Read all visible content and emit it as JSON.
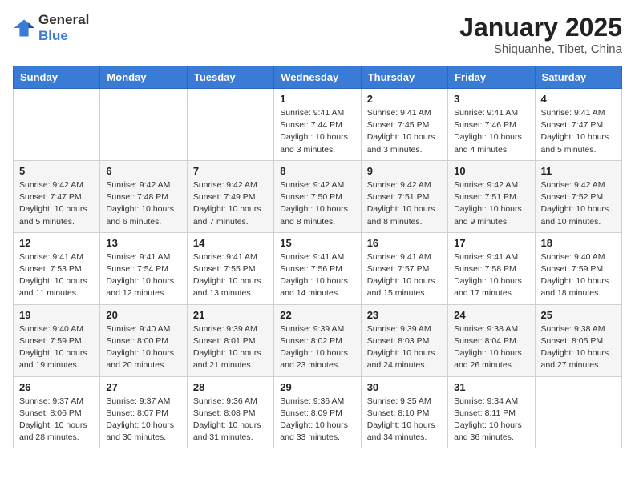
{
  "logo": {
    "general": "General",
    "blue": "Blue"
  },
  "title": "January 2025",
  "subtitle": "Shiquanhe, Tibet, China",
  "days_of_week": [
    "Sunday",
    "Monday",
    "Tuesday",
    "Wednesday",
    "Thursday",
    "Friday",
    "Saturday"
  ],
  "weeks": [
    [
      {
        "day": "",
        "info": ""
      },
      {
        "day": "",
        "info": ""
      },
      {
        "day": "",
        "info": ""
      },
      {
        "day": "1",
        "info": "Sunrise: 9:41 AM\nSunset: 7:44 PM\nDaylight: 10 hours\nand 3 minutes."
      },
      {
        "day": "2",
        "info": "Sunrise: 9:41 AM\nSunset: 7:45 PM\nDaylight: 10 hours\nand 3 minutes."
      },
      {
        "day": "3",
        "info": "Sunrise: 9:41 AM\nSunset: 7:46 PM\nDaylight: 10 hours\nand 4 minutes."
      },
      {
        "day": "4",
        "info": "Sunrise: 9:41 AM\nSunset: 7:47 PM\nDaylight: 10 hours\nand 5 minutes."
      }
    ],
    [
      {
        "day": "5",
        "info": "Sunrise: 9:42 AM\nSunset: 7:47 PM\nDaylight: 10 hours\nand 5 minutes."
      },
      {
        "day": "6",
        "info": "Sunrise: 9:42 AM\nSunset: 7:48 PM\nDaylight: 10 hours\nand 6 minutes."
      },
      {
        "day": "7",
        "info": "Sunrise: 9:42 AM\nSunset: 7:49 PM\nDaylight: 10 hours\nand 7 minutes."
      },
      {
        "day": "8",
        "info": "Sunrise: 9:42 AM\nSunset: 7:50 PM\nDaylight: 10 hours\nand 8 minutes."
      },
      {
        "day": "9",
        "info": "Sunrise: 9:42 AM\nSunset: 7:51 PM\nDaylight: 10 hours\nand 8 minutes."
      },
      {
        "day": "10",
        "info": "Sunrise: 9:42 AM\nSunset: 7:51 PM\nDaylight: 10 hours\nand 9 minutes."
      },
      {
        "day": "11",
        "info": "Sunrise: 9:42 AM\nSunset: 7:52 PM\nDaylight: 10 hours\nand 10 minutes."
      }
    ],
    [
      {
        "day": "12",
        "info": "Sunrise: 9:41 AM\nSunset: 7:53 PM\nDaylight: 10 hours\nand 11 minutes."
      },
      {
        "day": "13",
        "info": "Sunrise: 9:41 AM\nSunset: 7:54 PM\nDaylight: 10 hours\nand 12 minutes."
      },
      {
        "day": "14",
        "info": "Sunrise: 9:41 AM\nSunset: 7:55 PM\nDaylight: 10 hours\nand 13 minutes."
      },
      {
        "day": "15",
        "info": "Sunrise: 9:41 AM\nSunset: 7:56 PM\nDaylight: 10 hours\nand 14 minutes."
      },
      {
        "day": "16",
        "info": "Sunrise: 9:41 AM\nSunset: 7:57 PM\nDaylight: 10 hours\nand 15 minutes."
      },
      {
        "day": "17",
        "info": "Sunrise: 9:41 AM\nSunset: 7:58 PM\nDaylight: 10 hours\nand 17 minutes."
      },
      {
        "day": "18",
        "info": "Sunrise: 9:40 AM\nSunset: 7:59 PM\nDaylight: 10 hours\nand 18 minutes."
      }
    ],
    [
      {
        "day": "19",
        "info": "Sunrise: 9:40 AM\nSunset: 7:59 PM\nDaylight: 10 hours\nand 19 minutes."
      },
      {
        "day": "20",
        "info": "Sunrise: 9:40 AM\nSunset: 8:00 PM\nDaylight: 10 hours\nand 20 minutes."
      },
      {
        "day": "21",
        "info": "Sunrise: 9:39 AM\nSunset: 8:01 PM\nDaylight: 10 hours\nand 21 minutes."
      },
      {
        "day": "22",
        "info": "Sunrise: 9:39 AM\nSunset: 8:02 PM\nDaylight: 10 hours\nand 23 minutes."
      },
      {
        "day": "23",
        "info": "Sunrise: 9:39 AM\nSunset: 8:03 PM\nDaylight: 10 hours\nand 24 minutes."
      },
      {
        "day": "24",
        "info": "Sunrise: 9:38 AM\nSunset: 8:04 PM\nDaylight: 10 hours\nand 26 minutes."
      },
      {
        "day": "25",
        "info": "Sunrise: 9:38 AM\nSunset: 8:05 PM\nDaylight: 10 hours\nand 27 minutes."
      }
    ],
    [
      {
        "day": "26",
        "info": "Sunrise: 9:37 AM\nSunset: 8:06 PM\nDaylight: 10 hours\nand 28 minutes."
      },
      {
        "day": "27",
        "info": "Sunrise: 9:37 AM\nSunset: 8:07 PM\nDaylight: 10 hours\nand 30 minutes."
      },
      {
        "day": "28",
        "info": "Sunrise: 9:36 AM\nSunset: 8:08 PM\nDaylight: 10 hours\nand 31 minutes."
      },
      {
        "day": "29",
        "info": "Sunrise: 9:36 AM\nSunset: 8:09 PM\nDaylight: 10 hours\nand 33 minutes."
      },
      {
        "day": "30",
        "info": "Sunrise: 9:35 AM\nSunset: 8:10 PM\nDaylight: 10 hours\nand 34 minutes."
      },
      {
        "day": "31",
        "info": "Sunrise: 9:34 AM\nSunset: 8:11 PM\nDaylight: 10 hours\nand 36 minutes."
      },
      {
        "day": "",
        "info": ""
      }
    ]
  ]
}
